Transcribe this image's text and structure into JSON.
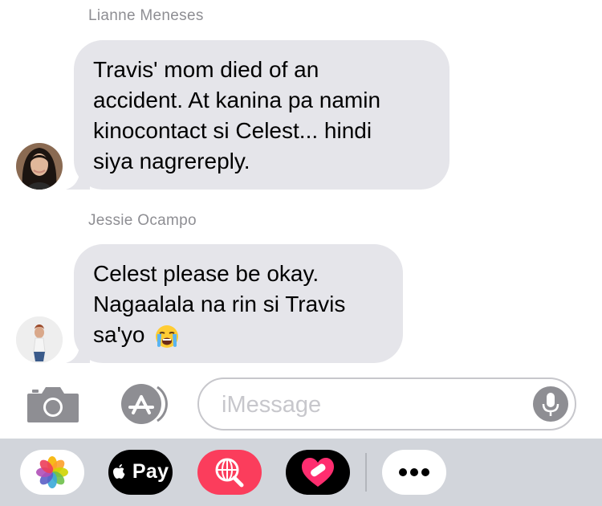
{
  "messages": [
    {
      "sender": "Lianne Meneses",
      "lines": [
        "Travis' mom died of an",
        "accident. At kanina pa namin",
        "kinocontact si Celest... hindi",
        "siya nagrereply."
      ]
    },
    {
      "sender": "Jessie Ocampo",
      "lines": [
        "Celest please be okay.",
        "Nagaalala na rin si Travis",
        "sa'yo"
      ],
      "emoji": "loudly-crying-face-emoji"
    }
  ],
  "composer": {
    "placeholder": "iMessage",
    "camera_icon": "camera-icon",
    "appstore_icon": "app-store-icon",
    "mic_icon": "microphone-icon"
  },
  "app_drawer": {
    "apps": [
      {
        "name": "photos",
        "icon": "photos-icon"
      },
      {
        "name": "apple-pay",
        "label": "Pay",
        "icon": "apple-logo-icon"
      },
      {
        "name": "images-search",
        "icon": "globe-search-icon"
      },
      {
        "name": "digital-touch",
        "icon": "heart-bandage-icon"
      },
      {
        "name": "more",
        "icon": "more-icon"
      }
    ]
  },
  "colors": {
    "bubble_gray": "#e5e5ea",
    "sender_gray": "#8e8e93",
    "drawer_bg": "#d2d5db",
    "images_pink": "#fb3d5c"
  }
}
